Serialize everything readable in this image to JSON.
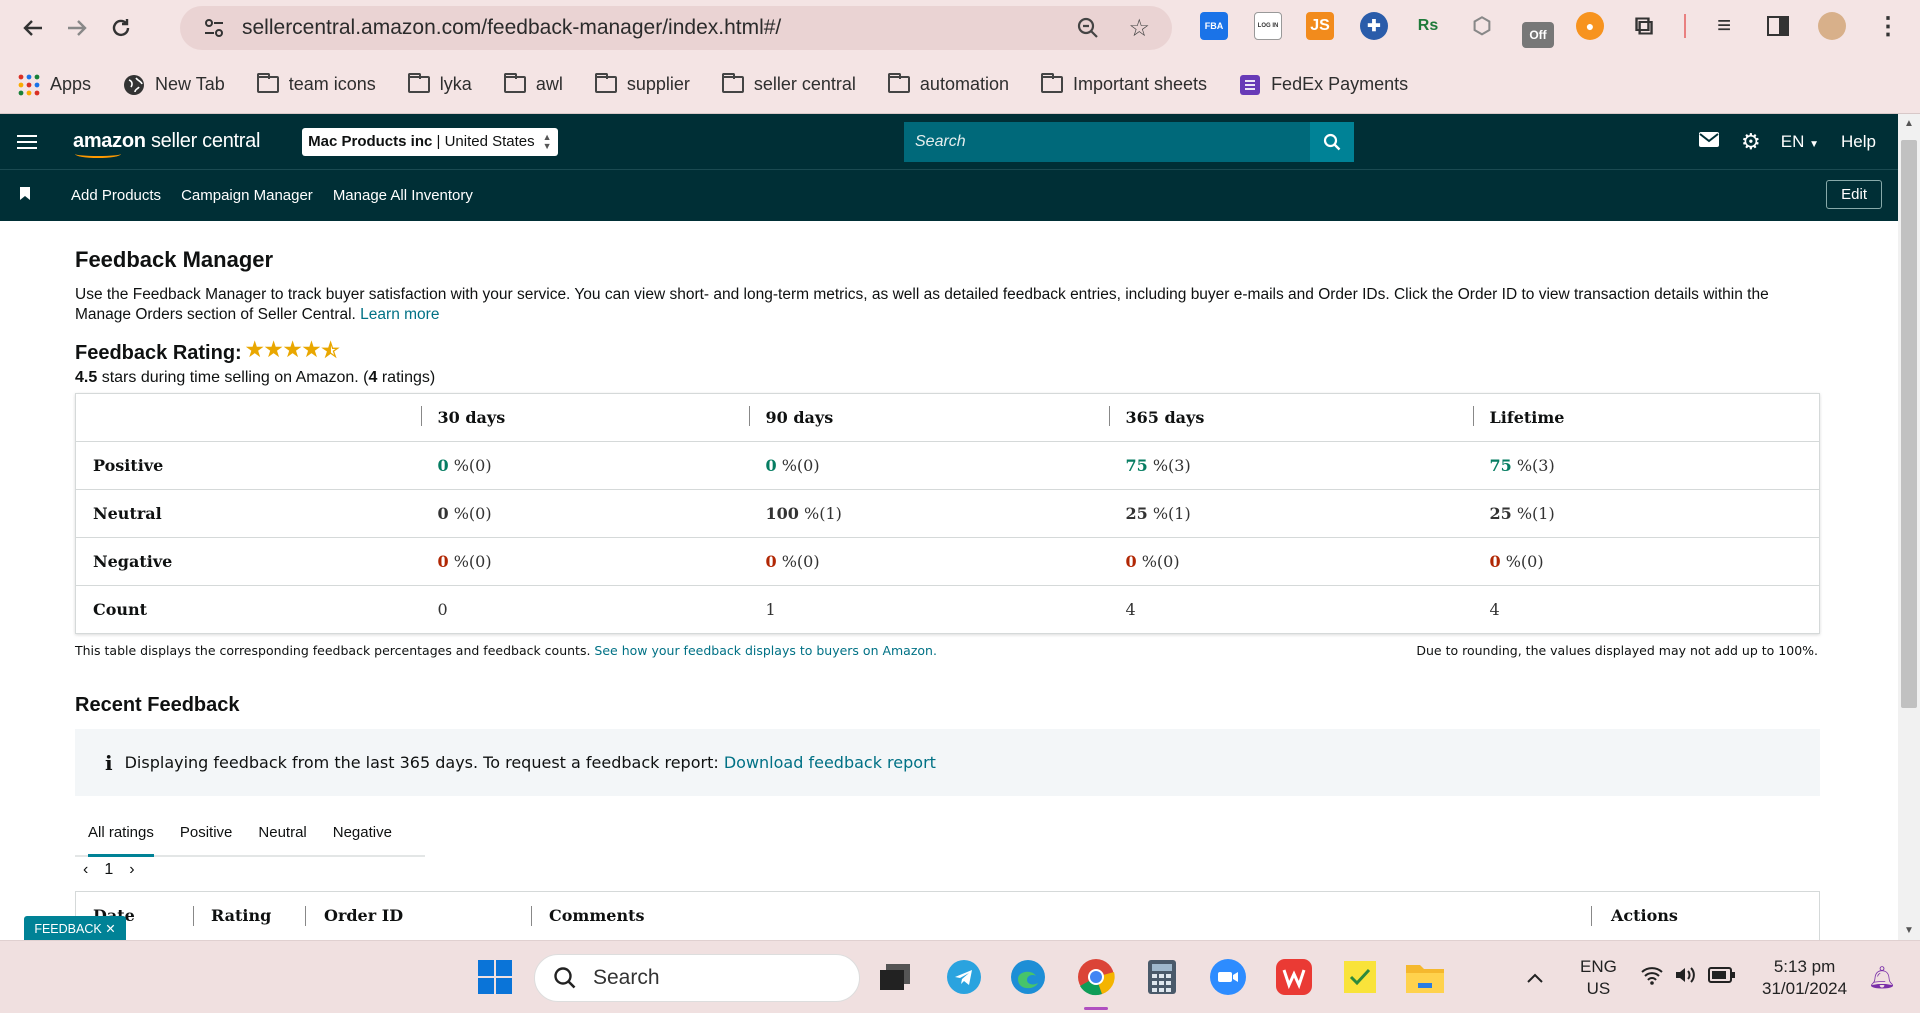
{
  "browser": {
    "url": "sellercentral.amazon.com/feedback-manager/index.html#/",
    "extensions": [
      "FBA",
      "LOG IN",
      "JS",
      "Rs"
    ],
    "ext_off_badge": "Off"
  },
  "bookmarks": [
    {
      "label": "Apps",
      "icon": "apps-grid-icon"
    },
    {
      "label": "New Tab",
      "icon": "globe-icon"
    },
    {
      "label": "team icons",
      "icon": "folder-icon"
    },
    {
      "label": "lyka",
      "icon": "folder-icon"
    },
    {
      "label": "awl",
      "icon": "folder-icon"
    },
    {
      "label": "supplier",
      "icon": "folder-icon"
    },
    {
      "label": "seller central",
      "icon": "folder-icon"
    },
    {
      "label": "automation",
      "icon": "folder-icon"
    },
    {
      "label": "Important sheets",
      "icon": "folder-icon"
    },
    {
      "label": "FedEx Payments",
      "icon": "form-icon"
    }
  ],
  "header": {
    "logo_amazon": "amazon",
    "logo_rest": "seller central",
    "account_name": "Mac Products inc",
    "account_sep": " | ",
    "account_market": "United States",
    "search_placeholder": "Search",
    "language": "EN",
    "help": "Help"
  },
  "subnav": {
    "links": [
      "Add Products",
      "Campaign Manager",
      "Manage All Inventory"
    ],
    "edit": "Edit"
  },
  "page": {
    "title": "Feedback Manager",
    "intro": "Use the Feedback Manager to track buyer satisfaction with your service. You can view short- and long-term metrics, as well as detailed feedback entries, including buyer e-mails and Order IDs. Click the Order ID to view transaction details within the Manage Orders section of Seller Central.",
    "learn_more": "Learn more",
    "rating_label": "Feedback Rating:",
    "rating_value": "4.5",
    "rating_stars": 4.5,
    "rating_text_mid": " stars during time selling on Amazon. (",
    "rating_count": "4",
    "rating_text_end": " ratings)"
  },
  "feedback_table": {
    "columns": [
      "30 days",
      "90 days",
      "365 days",
      "Lifetime"
    ],
    "rows": [
      {
        "label": "Positive",
        "cells": [
          [
            "0",
            " %(0)"
          ],
          [
            "0",
            " %(0)"
          ],
          [
            "75",
            " %(3)"
          ],
          [
            "75",
            " %(3)"
          ]
        ]
      },
      {
        "label": "Neutral",
        "cells": [
          [
            "0",
            " %(0)"
          ],
          [
            "100",
            " %(1)"
          ],
          [
            "25",
            " %(1)"
          ],
          [
            "25",
            " %(1)"
          ]
        ]
      },
      {
        "label": "Negative",
        "cells": [
          [
            "0",
            " %(0)"
          ],
          [
            "0",
            " %(0)"
          ],
          [
            "0",
            " %(0)"
          ],
          [
            "0",
            " %(0)"
          ]
        ]
      },
      {
        "label": "Count",
        "cells": [
          [
            "",
            "0"
          ],
          [
            "",
            "1"
          ],
          [
            "",
            "4"
          ],
          [
            "",
            "4"
          ]
        ]
      }
    ],
    "footnote_left": "This table displays the corresponding feedback percentages and feedback counts.",
    "footnote_link": "See how your feedback displays to buyers on Amazon.",
    "footnote_right": "Due to rounding, the values displayed may not add up to 100%."
  },
  "recent": {
    "title": "Recent Feedback",
    "alert_text": "Displaying feedback from the last 365 days. To request a feedback report:",
    "alert_link": "Download feedback report",
    "tabs": [
      "All ratings",
      "Positive",
      "Neutral",
      "Negative"
    ],
    "active_tab": 0,
    "page": "1",
    "columns": [
      "Date",
      "Rating",
      "Order ID",
      "Comments",
      "Actions"
    ]
  },
  "feedback_button": "FEEDBACK",
  "taskbar": {
    "search": "Search",
    "lang_top": "ENG",
    "lang_bottom": "US",
    "time": "5:13 pm",
    "date": "31/01/2024"
  },
  "colors": {
    "header_bg": "#002f36",
    "search_bg": "#00697a",
    "positive": "#067d62",
    "negative": "#b12704",
    "link": "#007185"
  }
}
